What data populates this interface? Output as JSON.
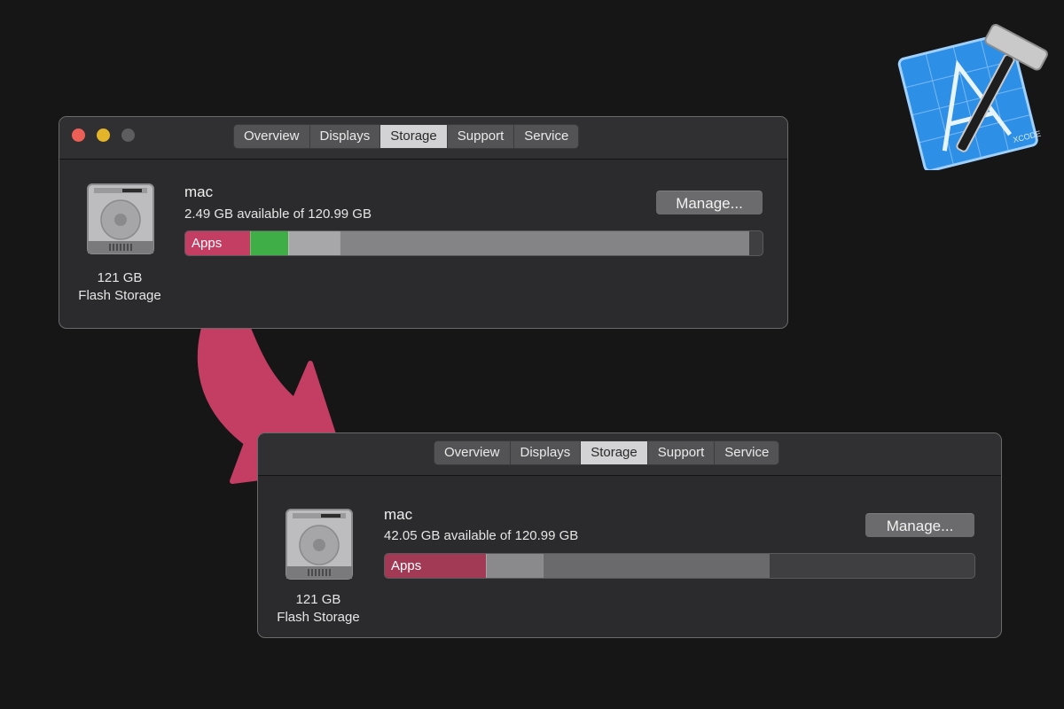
{
  "tabs": [
    "Overview",
    "Displays",
    "Storage",
    "Support",
    "Service"
  ],
  "selected_tab": "Storage",
  "before": {
    "volume_name": "mac",
    "available_text": "2.49 GB available of 120.99 GB",
    "manage_label": "Manage...",
    "disk_size": "121 GB",
    "disk_type": "Flash Storage",
    "bar_label": "Apps",
    "bar_segments": [
      {
        "fraction": 0.112,
        "color": "#c43e63"
      },
      {
        "fraction": 0.066,
        "color": "#3fae46"
      },
      {
        "fraction": 0.09,
        "color": "#a7a7a9"
      },
      {
        "fraction": 0.708,
        "color": "#848486"
      }
    ]
  },
  "after": {
    "volume_name": "mac",
    "available_text": "42.05 GB available of 120.99 GB",
    "manage_label": "Manage...",
    "disk_size": "121 GB",
    "disk_type": "Flash Storage",
    "bar_label": "Apps",
    "bar_segments": [
      {
        "fraction": 0.172,
        "color": "#a33a55"
      },
      {
        "fraction": 0.096,
        "color": "#8a8a8c"
      },
      {
        "fraction": 0.383,
        "color": "#6a6a6c"
      }
    ]
  },
  "colors": {
    "background": "#161616",
    "arrow": "#c43e63",
    "xcode_blue": "#2e8fe6"
  },
  "icons": [
    "hard-disk-icon",
    "curved-arrow-icon",
    "xcode-app-icon"
  ]
}
